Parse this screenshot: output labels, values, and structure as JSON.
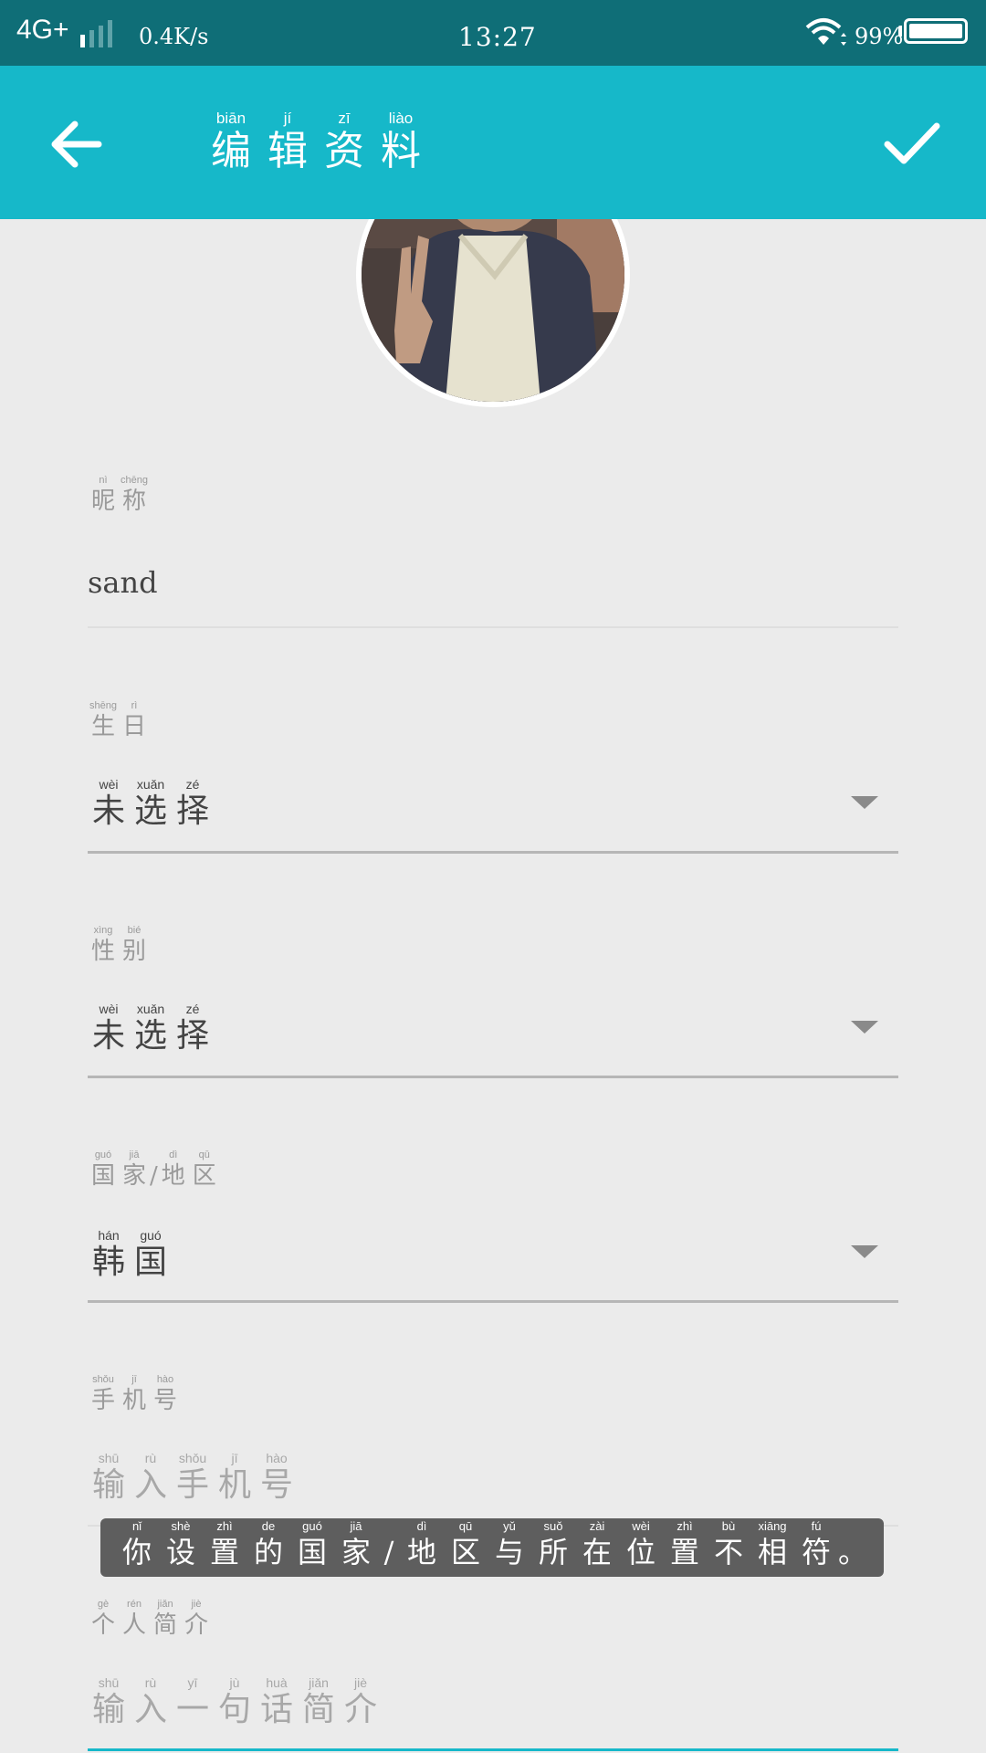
{
  "status_bar": {
    "network": "4G+",
    "speed": "0.4K/s",
    "time": "13:27",
    "battery": "99%"
  },
  "app_bar": {
    "back_icon": "arrow-left-icon",
    "confirm_icon": "checkmark-icon",
    "title": [
      {
        "py": "biān",
        "hz": "编"
      },
      {
        "py": "jí",
        "hz": "辑"
      },
      {
        "py": "zī",
        "hz": "资"
      },
      {
        "py": "liào",
        "hz": "料"
      }
    ]
  },
  "form": {
    "nickname": {
      "label": [
        {
          "py": "nì",
          "hz": "昵"
        },
        {
          "py": "chēng",
          "hz": "称"
        }
      ],
      "value": "sand"
    },
    "birthday": {
      "label": [
        {
          "py": "shēng",
          "hz": "生"
        },
        {
          "py": "rì",
          "hz": "日"
        }
      ],
      "value": [
        {
          "py": "wèi",
          "hz": "未"
        },
        {
          "py": "xuǎn",
          "hz": "选"
        },
        {
          "py": "zé",
          "hz": "择"
        }
      ]
    },
    "gender": {
      "label": [
        {
          "py": "xìng",
          "hz": "性"
        },
        {
          "py": "bié",
          "hz": "别"
        }
      ],
      "value": [
        {
          "py": "wèi",
          "hz": "未"
        },
        {
          "py": "xuǎn",
          "hz": "选"
        },
        {
          "py": "zé",
          "hz": "择"
        }
      ]
    },
    "region": {
      "label": [
        {
          "py": "guó",
          "hz": "国"
        },
        {
          "py": "jiā",
          "hz": "家"
        },
        {
          "py": "dì",
          "hz": "地"
        },
        {
          "py": "qū",
          "hz": "区"
        }
      ],
      "separator": "/",
      "value": [
        {
          "py": "hán",
          "hz": "韩"
        },
        {
          "py": "guó",
          "hz": "国"
        }
      ]
    },
    "phone": {
      "label": [
        {
          "py": "shǒu",
          "hz": "手"
        },
        {
          "py": "jī",
          "hz": "机"
        },
        {
          "py": "hào",
          "hz": "号"
        }
      ],
      "placeholder": [
        {
          "py": "shū",
          "hz": "输"
        },
        {
          "py": "rù",
          "hz": "入"
        },
        {
          "py": "shǒu",
          "hz": "手"
        },
        {
          "py": "jī",
          "hz": "机"
        },
        {
          "py": "hào",
          "hz": "号"
        }
      ]
    },
    "bio": {
      "label": [
        {
          "py": "gè",
          "hz": "个"
        },
        {
          "py": "rén",
          "hz": "人"
        },
        {
          "py": "jiǎn",
          "hz": "简"
        },
        {
          "py": "jiè",
          "hz": "介"
        }
      ],
      "placeholder": [
        {
          "py": "shū",
          "hz": "输"
        },
        {
          "py": "rù",
          "hz": "入"
        },
        {
          "py": "yī",
          "hz": "一"
        },
        {
          "py": "jù",
          "hz": "句"
        },
        {
          "py": "huà",
          "hz": "话"
        },
        {
          "py": "jiǎn",
          "hz": "简"
        },
        {
          "py": "jiè",
          "hz": "介"
        }
      ]
    }
  },
  "toast": {
    "message": [
      {
        "py": "nǐ",
        "hz": "你"
      },
      {
        "py": "shè",
        "hz": "设"
      },
      {
        "py": "zhì",
        "hz": "置"
      },
      {
        "py": "de",
        "hz": "的"
      },
      {
        "py": "guó",
        "hz": "国"
      },
      {
        "py": "jiā",
        "hz": "家"
      },
      {
        "py": "",
        "hz": "/"
      },
      {
        "py": "dì",
        "hz": "地"
      },
      {
        "py": "qū",
        "hz": "区"
      },
      {
        "py": "yǔ",
        "hz": "与"
      },
      {
        "py": "suǒ",
        "hz": "所"
      },
      {
        "py": "zài",
        "hz": "在"
      },
      {
        "py": "wèi",
        "hz": "位"
      },
      {
        "py": "zhì",
        "hz": "置"
      },
      {
        "py": "bù",
        "hz": "不"
      },
      {
        "py": "xiāng",
        "hz": "相"
      },
      {
        "py": "fú",
        "hz": "符"
      },
      {
        "py": "",
        "hz": "。"
      }
    ]
  }
}
